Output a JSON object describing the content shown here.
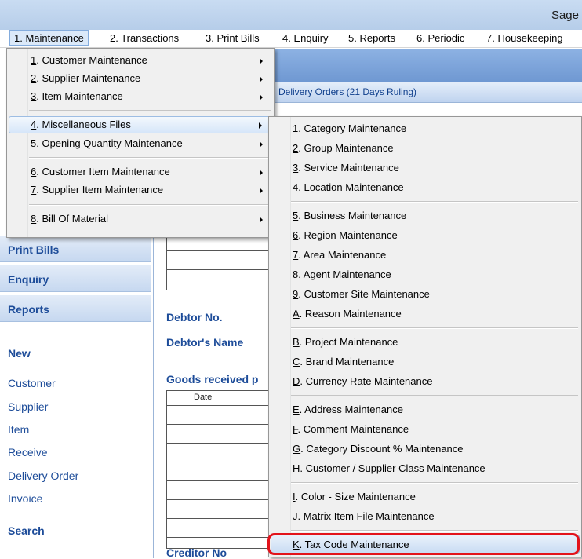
{
  "window": {
    "title": "Sage"
  },
  "menubar": [
    "1. Maintenance",
    "2. Transactions",
    "3. Print Bills",
    "4. Enquiry",
    "5. Reports",
    "6. Periodic",
    "7. Housekeeping"
  ],
  "maintenance_menu": [
    {
      "key": "1",
      "label": ". Customer Maintenance"
    },
    {
      "key": "2",
      "label": ". Supplier Maintenance"
    },
    {
      "key": "3",
      "label": ". Item Maintenance"
    },
    {
      "key": "4",
      "label": ". Miscellaneous Files"
    },
    {
      "key": "5",
      "label": ". Opening Quantity Maintenance"
    },
    {
      "key": "6",
      "label": ". Customer Item Maintenance"
    },
    {
      "key": "7",
      "label": ". Supplier Item Maintenance"
    },
    {
      "key": "8",
      "label": ". Bill Of Material"
    }
  ],
  "misc_menu": [
    {
      "key": "1",
      "label": ". Category Maintenance"
    },
    {
      "key": "2",
      "label": ". Group Maintenance"
    },
    {
      "key": "3",
      "label": ". Service Maintenance"
    },
    {
      "key": "4",
      "label": ". Location Maintenance"
    },
    {
      "key": "5",
      "label": ". Business Maintenance"
    },
    {
      "key": "6",
      "label": ". Region Maintenance"
    },
    {
      "key": "7",
      "label": ". Area Maintenance"
    },
    {
      "key": "8",
      "label": ". Agent Maintenance"
    },
    {
      "key": "9",
      "label": ". Customer Site Maintenance"
    },
    {
      "key": "A",
      "label": ". Reason Maintenance"
    },
    {
      "key": "B",
      "label": ". Project Maintenance"
    },
    {
      "key": "C",
      "label": ". Brand Maintenance"
    },
    {
      "key": "D",
      "label": ". Currency Rate Maintenance"
    },
    {
      "key": "E",
      "label": ". Address Maintenance"
    },
    {
      "key": "F",
      "label": ". Comment Maintenance"
    },
    {
      "key": "G",
      "label": ". Category Discount % Maintenance"
    },
    {
      "key": "H",
      "label": ". Customer / Supplier Class Maintenance"
    },
    {
      "key": "I",
      "label": ". Color - Size Maintenance"
    },
    {
      "key": "J",
      "label": ". Matrix Item File Maintenance"
    },
    {
      "key": "K",
      "label": ". Tax Code Maintenance"
    }
  ],
  "background": {
    "delivery_header": "Delivery Orders (21 Days Ruling)",
    "debtor_no": "Debtor No.",
    "debtor_name": "Debtor's Name",
    "goods_received": "Goods received p",
    "grid_date_header": "Date",
    "creditor_no": "Creditor No"
  },
  "sidebar": {
    "buttons": [
      "Print Bills",
      "Enquiry",
      "Reports"
    ],
    "new_label": "New",
    "new_links": [
      "Customer",
      "Supplier",
      "Item",
      "Receive",
      "Delivery Order",
      "Invoice"
    ],
    "search_label": "Search"
  },
  "colors": {
    "highlight_ring": "#e3131b",
    "link_blue": "#1d4c99"
  }
}
